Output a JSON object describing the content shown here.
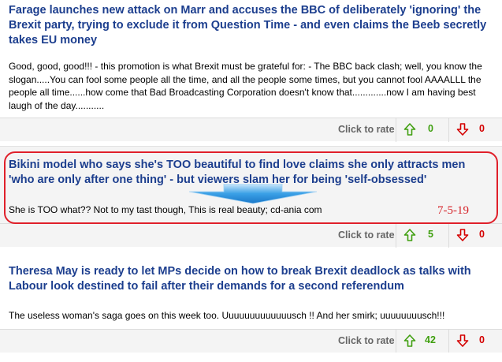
{
  "colors": {
    "title": "#1c3e8e",
    "up": "#3f9f0f",
    "down": "#d40000",
    "annotation": "#e0202a",
    "background": "#f4f4f4"
  },
  "comments": [
    {
      "headline": "Farage launches new attack on Marr and accuses the BBC of deliberately 'ignoring' the Brexit party, trying to exclude it from Question Time - and even claims the Beeb secretly takes EU money",
      "body": "Good, good, good!!! - this promotion is what Brexit must be grateful for: - The BBC back clash; well, you know the slogan.....You can fool some people all the time, and all the people some times, but you cannot fool AAAALLL the people all time......how come that Bad Broadcasting Corporation doesn't know that.............now I am having best laugh of the day...........",
      "rate_label": "Click to rate",
      "up_votes": "0",
      "down_votes": "0",
      "up_icon": "up-arrow-icon",
      "down_icon": "down-arrow-icon"
    },
    {
      "headline": "Bikini model who says she's TOO beautiful to find love claims she only attracts men 'who are only after one thing' - but viewers slam her for being 'self-obsessed'",
      "body": "She is TOO what?? Not to my tast though, This is real beauty; cd-ania com",
      "rate_label": "Click to rate",
      "up_votes": "5",
      "down_votes": "0",
      "up_icon": "up-arrow-icon",
      "down_icon": "down-arrow-icon"
    },
    {
      "headline": "Theresa May is ready to let MPs decide on how to break Brexit deadlock as talks with Labour look destined to fail after their demands for a second referendum",
      "body": "The useless woman's saga goes on this week too. Uuuuuuuuuuuuusch !! And her smirk; uuuuuuuusch!!!",
      "rate_label": "Click to rate",
      "up_votes": "42",
      "down_votes": "0",
      "up_icon": "up-arrow-icon",
      "down_icon": "down-arrow-icon"
    }
  ],
  "annotation": {
    "date": "7-5-19",
    "arrow_icon": "blue-down-arrow-icon"
  }
}
